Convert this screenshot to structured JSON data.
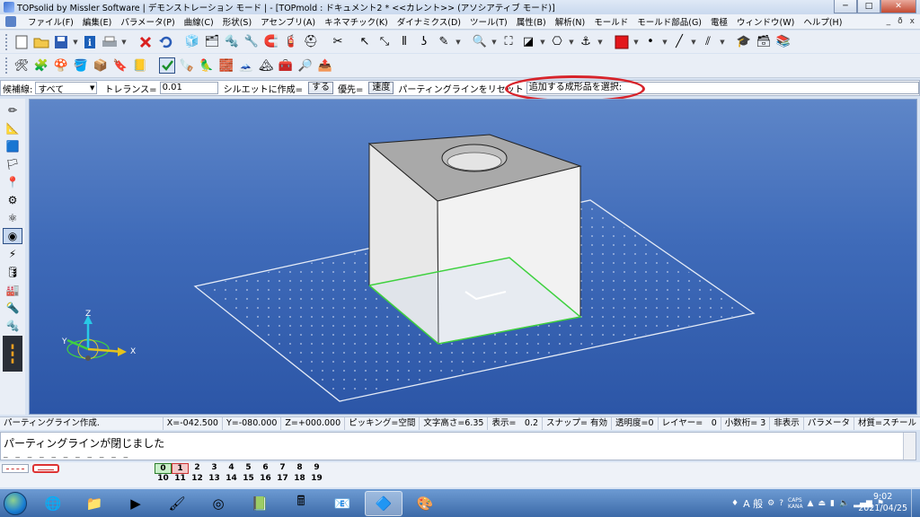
{
  "window": {
    "title": "TOPsolid by Missler Software | デモンストレーション モード | - [TOPmold : ドキュメント2 *  <<カレント>> (アソシアティブ モード)]",
    "minimize": "─",
    "maximize": "□",
    "close": "✕"
  },
  "menu": {
    "items": [
      "ファイル(F)",
      "編集(E)",
      "パラメータ(P)",
      "曲線(C)",
      "形状(S)",
      "アセンブリ(A)",
      "キネマチック(K)",
      "ダイナミクス(D)",
      "ツール(T)",
      "属性(B)",
      "解析(N)",
      "モールド",
      "モールド部品(G)",
      "電極",
      "ウィンドウ(W)",
      "ヘルプ(H)"
    ],
    "mdi_minimize": "_",
    "mdi_restore": "ð",
    "mdi_close": "x"
  },
  "status": {
    "candidate_label": "候補線:",
    "candidate_value": "すべて",
    "tolerance_label": "トレランス=",
    "tolerance_value": "0.01",
    "silhouette_label": "シルエットに作成=",
    "silhouette_button": "する",
    "priority_label": "優先=",
    "priority_button": "速度",
    "reset_label": "パーティングラインをリセット",
    "prompt": "追加する成形品を選択:"
  },
  "viewport": {
    "axis_z": "Z",
    "axis_y": "Y",
    "axis_x": "X"
  },
  "infobar": {
    "message": "パーティングライン作成.",
    "x": "X=-042.500",
    "y": "Y=-080.000",
    "z": "Z=+000.000",
    "picking": "ピッキング=空間",
    "text_height": "文字高さ=6.35",
    "display": "表示=　0.2",
    "snap": "スナップ= 有効",
    "transparency": "透明度=0",
    "layer": "レイヤー=　0",
    "decimals": "小数桁= 3",
    "hide": "非表示",
    "parameter": "パラメータ",
    "material": "材質=スチール"
  },
  "messages": {
    "main": "パーティングラインが閉じました",
    "dashes": "_ _ _ _ _ _ _ _ _ _ _"
  },
  "layers": {
    "row1": [
      "0",
      "1",
      "2",
      "3",
      "4",
      "5",
      "6",
      "7",
      "8",
      "9"
    ],
    "row2": [
      "10",
      "11",
      "12",
      "13",
      "14",
      "15",
      "16",
      "17",
      "18",
      "19"
    ]
  },
  "taskbar": {
    "tray_lang": "A 般",
    "caps": "CAPS",
    "kana": "KANA",
    "time": "9:02",
    "date": "2021/04/25"
  },
  "colors": {
    "highlight": "#d7232a",
    "parting_line": "#3fd13f",
    "viewport_top": "#5e86c8",
    "viewport_bottom": "#2c56a7"
  }
}
